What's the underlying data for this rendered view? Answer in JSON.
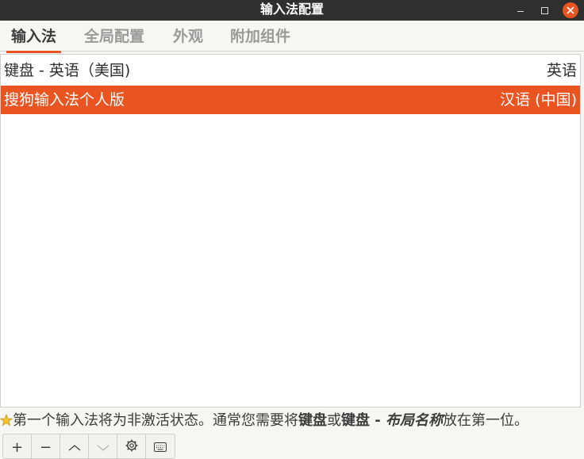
{
  "window": {
    "title": "输入法配置"
  },
  "tabs": [
    {
      "label": "输入法"
    },
    {
      "label": "全局配置"
    },
    {
      "label": "外观"
    },
    {
      "label": "附加组件"
    }
  ],
  "input_methods": [
    {
      "name": "键盘 - 英语（美国)",
      "language": "英语",
      "selected": false
    },
    {
      "name": "搜狗输入法个人版",
      "language": "汉语 (中国)",
      "selected": true
    }
  ],
  "hint": {
    "icon": "star-icon",
    "part1": "第一个输入法将为非激活状态。通常您需要将",
    "bold1": "键盘",
    "part2": "或",
    "bold2": "键盘 - ",
    "bold_italic": "布局名称",
    "part3": "放在第一位。"
  },
  "toolbar": {
    "add": "+",
    "remove": "−",
    "move_up": "︿",
    "move_down": "﹀"
  },
  "colors": {
    "accent": "#e95420",
    "titlebar": "#2f2f2f"
  }
}
